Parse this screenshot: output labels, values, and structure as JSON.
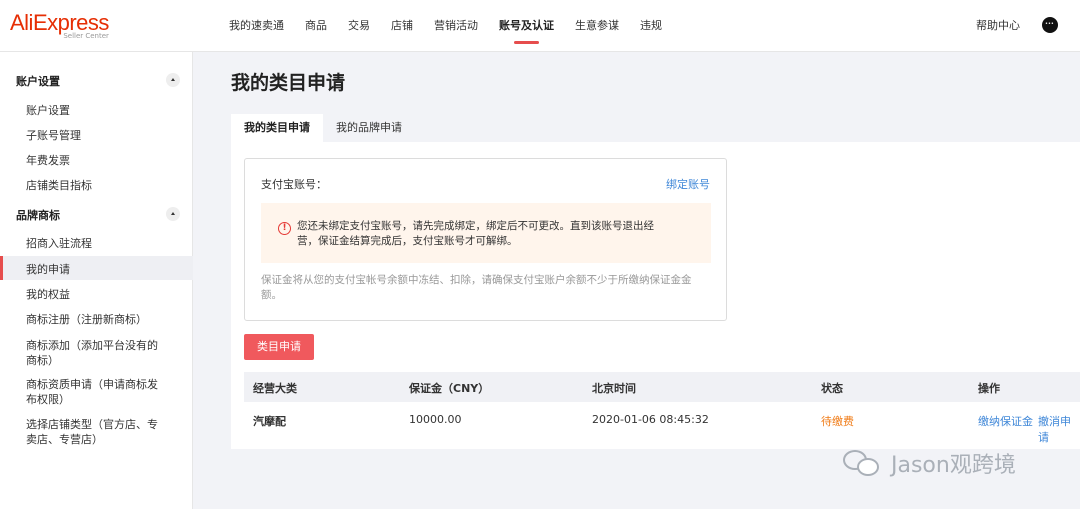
{
  "logo": {
    "brand": "AliExpress",
    "sub": "Seller Center"
  },
  "nav": {
    "items": [
      "我的速卖通",
      "商品",
      "交易",
      "店铺",
      "营销活动",
      "账号及认证",
      "生意参谋",
      "违规"
    ],
    "active": "账号及认证",
    "help": "帮助中心"
  },
  "sidebar": {
    "groups": [
      {
        "title": "账户设置",
        "items": [
          "账户设置",
          "子账号管理",
          "年费发票",
          "店铺类目指标"
        ]
      },
      {
        "title": "品牌商标",
        "items": [
          "招商入驻流程",
          "我的申请",
          "我的权益",
          "商标注册（注册新商标）",
          "商标添加（添加平台没有的商标）",
          "商标资质申请（申请商标发布权限）",
          "选择店铺类型（官方店、专卖店、专营店）"
        ]
      }
    ],
    "active_item": "我的申请"
  },
  "main": {
    "title": "我的类目申请",
    "tabs": [
      "我的类目申请",
      "我的品牌申请"
    ],
    "alipay": {
      "label": "支付宝账号：",
      "bind_link": "绑定账号",
      "warning": "您还未绑定支付宝账号，请先完成绑定，绑定后不可更改。直到该账号退出经营，保证金结算完成后，支付宝账号才可解绑。",
      "note": "保证金将从您的支付宝帐号余额中冻结、扣除，请确保支付宝账户余额不少于所缴纳保证金金额。"
    },
    "apply_button": "类目申请",
    "table": {
      "headers": [
        "经营大类",
        "保证金（CNY）",
        "北京时间",
        "状态",
        "操作"
      ],
      "rows": [
        {
          "category": "汽摩配",
          "deposit": "10000.00",
          "time": "2020-01-06 08:45:32",
          "status": "待缴费",
          "actions": [
            "缴纳保证金",
            "撤消申请"
          ]
        }
      ]
    }
  },
  "watermark": "Jason观跨境",
  "colors": {
    "brand": "#e62e04",
    "accent": "#e64d4d",
    "link": "#3f87d8",
    "warning_bg": "#fff5ec",
    "status_pending": "#f07c18"
  }
}
